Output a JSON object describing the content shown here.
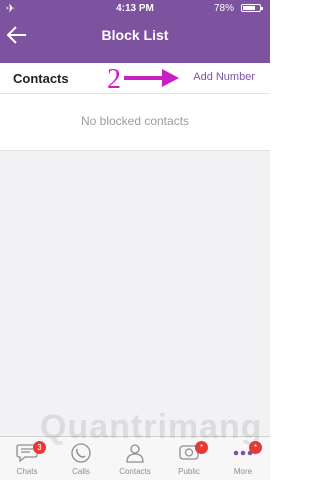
{
  "status_bar": {
    "time": "4:13 PM",
    "battery": "78%",
    "battery_level": 0.78
  },
  "header": {
    "title": "Block List",
    "back_icon": "back-arrow-icon"
  },
  "contacts_row": {
    "label": "Contacts",
    "action": "Add Number",
    "annotation_number": "2"
  },
  "empty_state": {
    "text": "No blocked contacts"
  },
  "tabs": [
    {
      "label": "Chats",
      "icon": "chat-bubble-icon",
      "badge": "3"
    },
    {
      "label": "Calls",
      "icon": "phone-icon",
      "badge": ""
    },
    {
      "label": "Contacts",
      "icon": "person-icon",
      "badge": ""
    },
    {
      "label": "Public",
      "icon": "public-chat-icon",
      "badge": "*"
    },
    {
      "label": "More",
      "icon": "more-dots-icon",
      "badge": "*"
    }
  ],
  "watermark": "Quantrimang",
  "colors": {
    "accent": "#7d529f",
    "annotation": "#c81fc4",
    "badge": "#e53935"
  }
}
